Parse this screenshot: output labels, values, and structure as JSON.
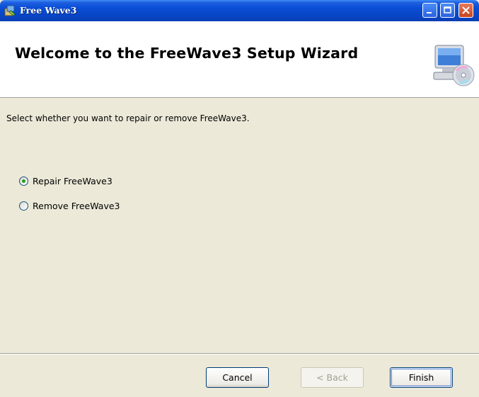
{
  "window": {
    "title": "Free Wave3",
    "controls": {
      "minimize": "minimize-icon",
      "maximize": "maximize-icon",
      "close": "close-icon"
    }
  },
  "header": {
    "title": "Welcome to the FreeWave3 Setup Wizard",
    "icon": "computer-cd-icon"
  },
  "body": {
    "instruction": "Select whether you want to repair or remove FreeWave3.",
    "options": [
      {
        "label": "Repair FreeWave3",
        "selected": true
      },
      {
        "label": "Remove FreeWave3",
        "selected": false
      }
    ]
  },
  "buttons": {
    "cancel": "Cancel",
    "back": "< Back",
    "finish": "Finish"
  },
  "colors": {
    "titlebar": "#0a4fd6",
    "dialog_bg": "#ece9d8",
    "header_bg": "#ffffff",
    "radio_dot": "#21a121"
  }
}
